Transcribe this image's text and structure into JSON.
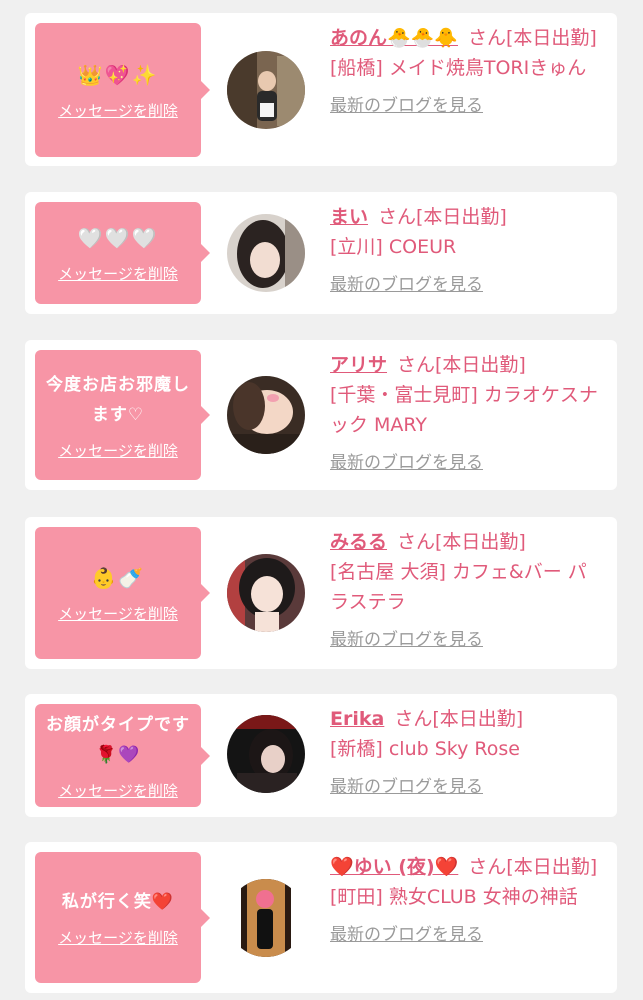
{
  "messages": [
    {
      "bubble_text": "👑💖✨",
      "delete_label": "メッセージを削除",
      "name": "あのん🐣🐣🐥",
      "honorific": "さん[本日出勤]",
      "shop": "[船橋] メイド焼鳥TORIきゅん",
      "blog_label": "最新のブログを見る"
    },
    {
      "bubble_text": "🤍🤍🤍",
      "delete_label": "メッセージを削除",
      "name": "まい",
      "honorific": "さん[本日出勤]",
      "shop": "[立川] COEUR",
      "blog_label": "最新のブログを見る"
    },
    {
      "bubble_text": "今度お店お邪魔します♡",
      "delete_label": "メッセージを削除",
      "name": "アリサ",
      "honorific": "さん[本日出勤]",
      "shop": "[千葉・富士見町] カラオケスナック MARY",
      "blog_label": "最新のブログを見る"
    },
    {
      "bubble_text": "👶🍼",
      "delete_label": "メッセージを削除",
      "name": "みるる",
      "honorific": "さん[本日出勤]",
      "shop": "[名古屋 大須] カフェ&バー パラステラ",
      "blog_label": "最新のブログを見る"
    },
    {
      "bubble_text": "お顔がタイプです🌹💜",
      "delete_label": "メッセージを削除",
      "name": "Erika",
      "honorific": "さん[本日出勤]",
      "shop": "[新橋] club Sky Rose",
      "blog_label": "最新のブログを見る"
    },
    {
      "bubble_text": "私が行く笑❤️",
      "delete_label": "メッセージを削除",
      "name": "❤️ゆい (夜)❤️",
      "honorific": "さん[本日出勤]",
      "shop": "[町田] 熟女CLUB 女神の神話",
      "blog_label": "最新のブログを見る"
    }
  ],
  "colors": {
    "accent": "#e05a7a",
    "bubble": "#f795a6",
    "link_gray": "#9a9a9a",
    "background": "#f0f0f0"
  }
}
